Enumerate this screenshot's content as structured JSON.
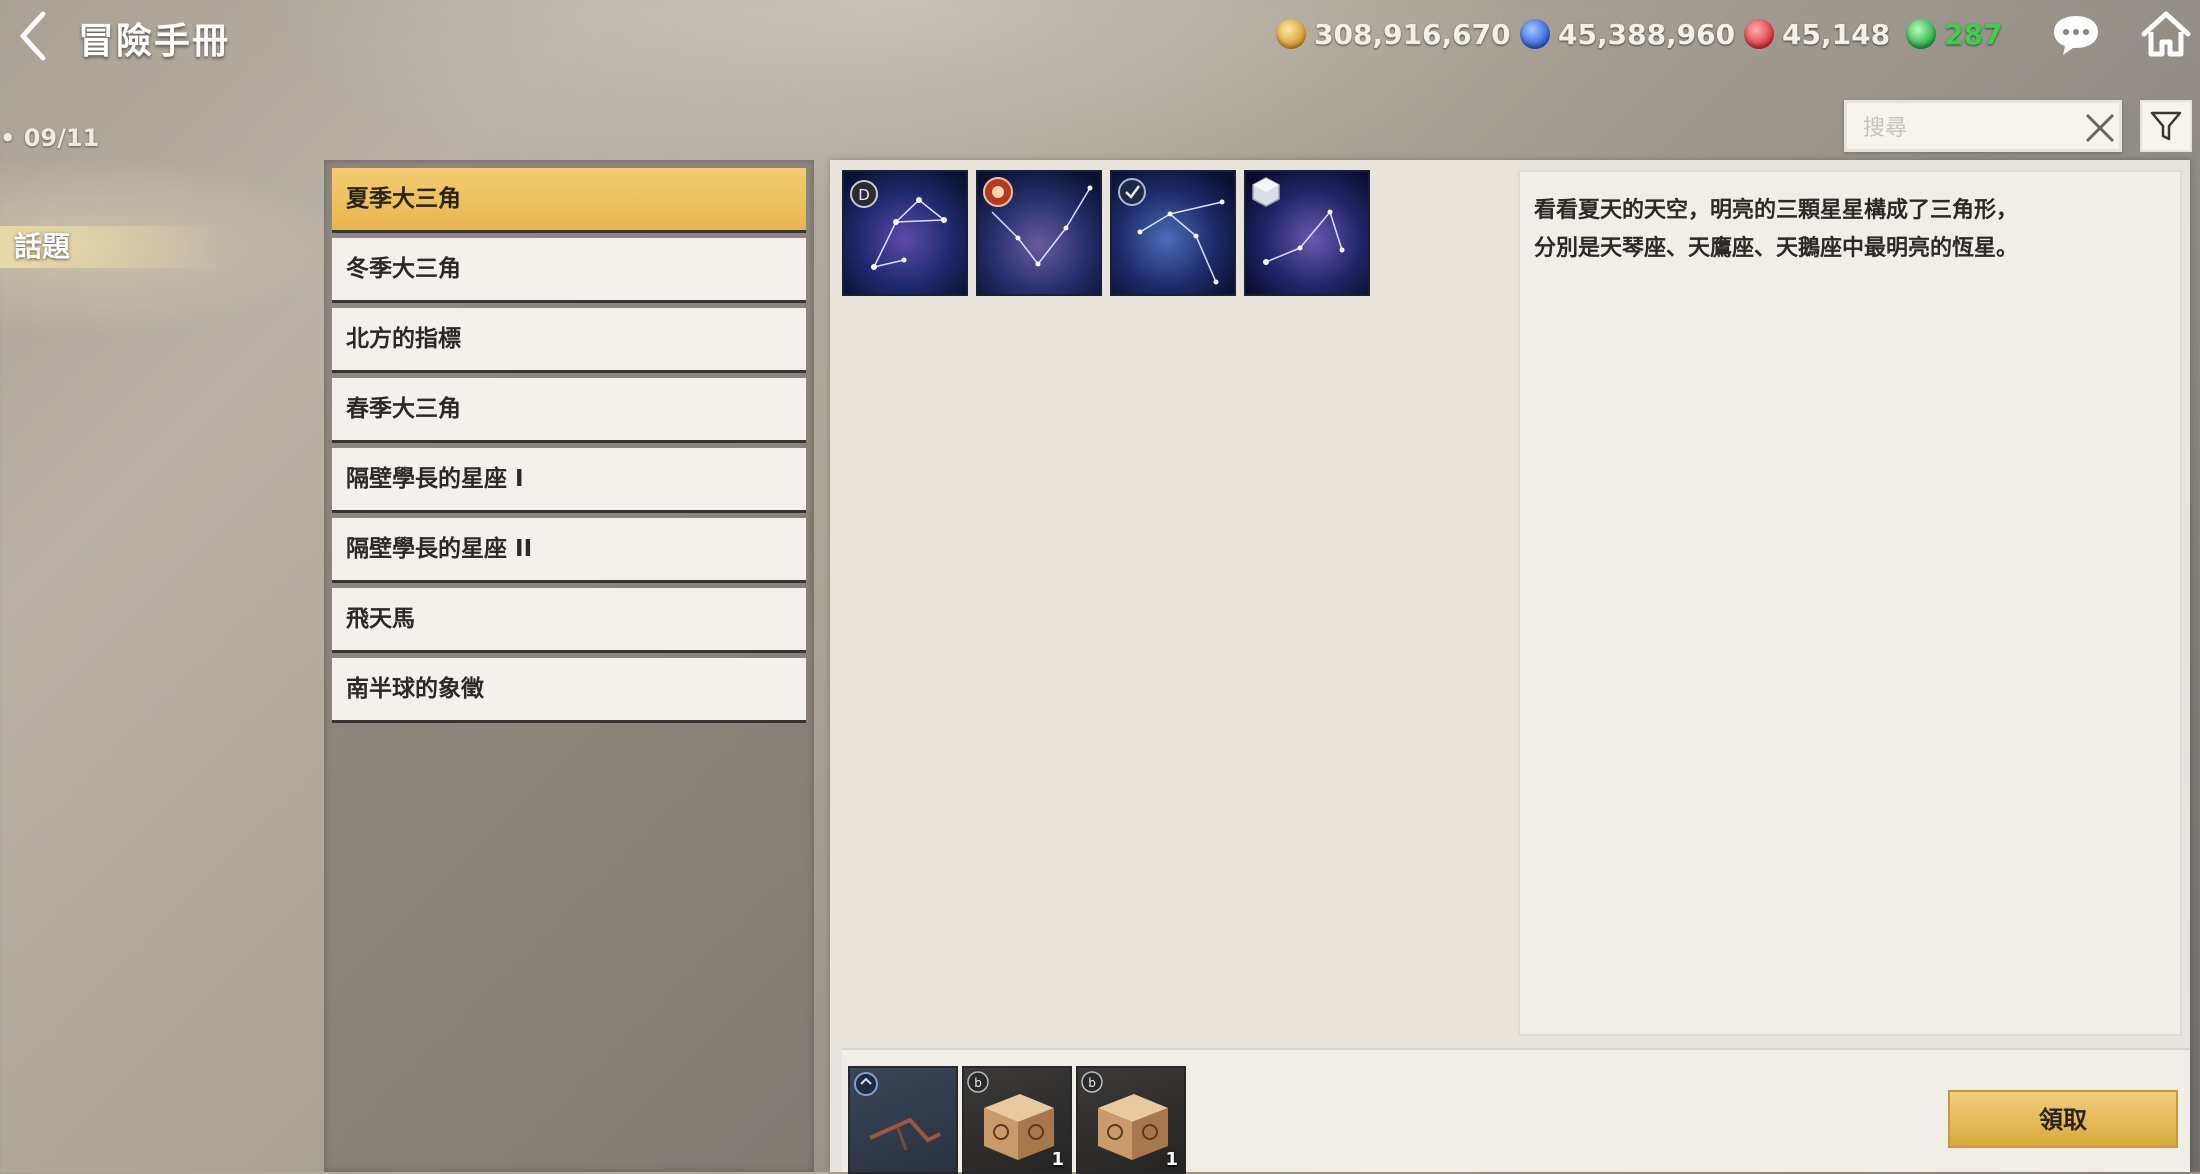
{
  "header": {
    "title": "冒險手冊"
  },
  "currencies": [
    {
      "icon": "gold-coin-icon",
      "value": "308,916,670",
      "color": "#d19a2a"
    },
    {
      "icon": "blue-gem-icon",
      "value": "45,388,960",
      "color": "#2e5cd6"
    },
    {
      "icon": "red-gem-icon",
      "value": "45,148",
      "color": "#d5303c"
    },
    {
      "icon": "green-token-icon",
      "value": "287",
      "color": "#23a84a"
    }
  ],
  "left": {
    "sub_label": "• 09/11",
    "category": "話題"
  },
  "search": {
    "placeholder": "搜尋"
  },
  "list": {
    "items": [
      "夏季大三角",
      "冬季大三角",
      "北方的指標",
      "春季大三角",
      "隔壁學長的星座 I",
      "隔壁學長的星座 II",
      "飛天馬",
      "南半球的象徵"
    ],
    "active_index": 0
  },
  "detail": {
    "description_line1": "看看夏天的天空，明亮的三顆星星構成了三角形，",
    "description_line2": "分別是天琴座、天鷹座、天鵝座中最明亮的恆星。",
    "thumbnails": [
      "constellation-1",
      "constellation-2",
      "constellation-3",
      "constellation-4"
    ]
  },
  "rewards": {
    "items": [
      {
        "icon": "arrow-item-icon",
        "count": ""
      },
      {
        "icon": "treasure-box-icon",
        "count": "1"
      },
      {
        "icon": "treasure-box-icon",
        "count": "1"
      }
    ],
    "claim_label": "領取"
  },
  "colors": {
    "accent_gold": "#e8b54e",
    "panel_bg": "#e8e4dc",
    "list_item_bg": "#f4f1ec"
  }
}
